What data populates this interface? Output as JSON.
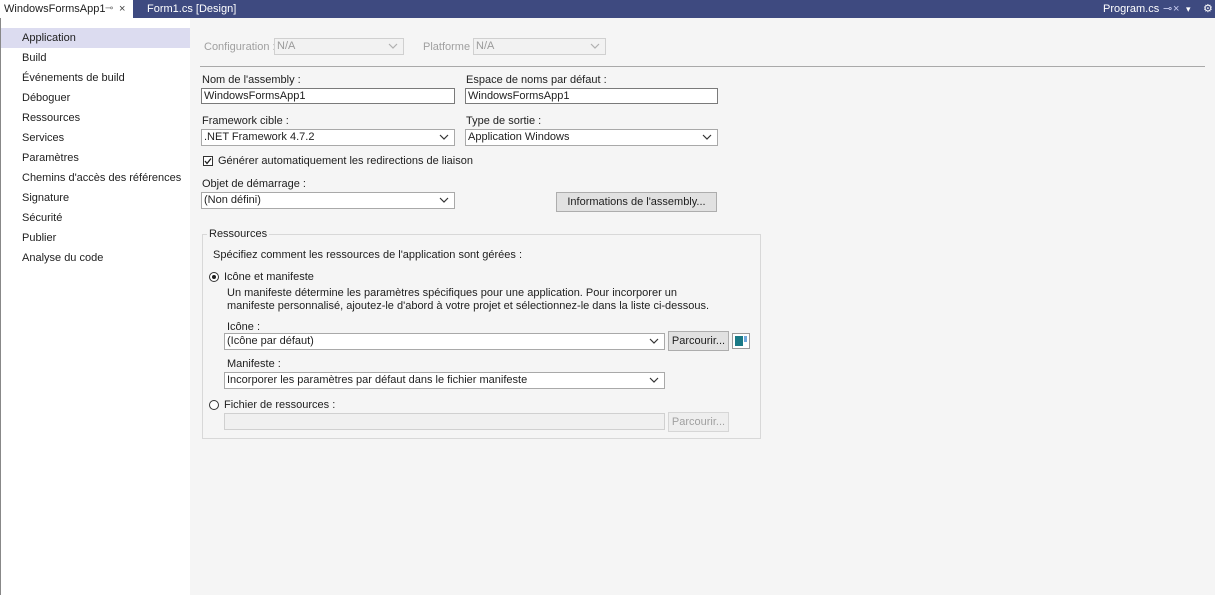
{
  "tabs": {
    "active_label": "WindowsFormsApp1",
    "second_label": "Form1.cs [Design]",
    "right_label": "Program.cs",
    "pin_glyph": "⊸",
    "close_glyph": "×"
  },
  "sidebar": {
    "items": [
      {
        "label": "Application"
      },
      {
        "label": "Build"
      },
      {
        "label": "Événements de build"
      },
      {
        "label": "Déboguer"
      },
      {
        "label": "Ressources"
      },
      {
        "label": "Services"
      },
      {
        "label": "Paramètres"
      },
      {
        "label": "Chemins d'accès des références"
      },
      {
        "label": "Signature"
      },
      {
        "label": "Sécurité"
      },
      {
        "label": "Publier"
      },
      {
        "label": "Analyse du code"
      }
    ],
    "active_index": 0
  },
  "config": {
    "configuration_label": "Configuration :",
    "configuration_value": "N/A",
    "platform_label": "Platforme :",
    "platform_value": "N/A"
  },
  "form": {
    "assembly_name_label": "Nom de l'assembly :",
    "assembly_name_value": "WindowsFormsApp1",
    "namespace_label": "Espace de noms par défaut :",
    "namespace_value": "WindowsFormsApp1",
    "framework_label": "Framework cible :",
    "framework_value": ".NET Framework 4.7.2",
    "output_type_label": "Type de sortie :",
    "output_type_value": "Application Windows",
    "auto_redirect_label": "Générer automatiquement les redirections de liaison",
    "auto_redirect_checked": true,
    "startup_object_label": "Objet de démarrage :",
    "startup_object_value": "(Non défini)",
    "assembly_info_button": "Informations de l'assembly..."
  },
  "resources": {
    "group_title": "Ressources",
    "description": "Spécifiez comment les ressources de l'application sont gérées :",
    "icon_manifest_label": "Icône et manifeste",
    "icon_manifest_selected": true,
    "manifest_help_line1": "Un manifeste détermine les paramètres spécifiques pour une application. Pour incorporer un",
    "manifest_help_line2": "manifeste personnalisé, ajoutez-le d'abord à votre projet et sélectionnez-le dans la liste ci-dessous.",
    "icon_label": "Icône :",
    "icon_value": "(Icône par défaut)",
    "browse_button": "Parcourir...",
    "manifest_label": "Manifeste :",
    "manifest_value": "Incorporer les paramètres par défaut dans le fichier manifeste",
    "resource_file_label": "Fichier de ressources :",
    "resource_file_selected": false,
    "resource_file_value": "",
    "browse_button_disabled": "Parcourir..."
  },
  "colors": {
    "tabbar_bg": "#3e4a80",
    "active_nav_bg": "#dcdcf0"
  }
}
